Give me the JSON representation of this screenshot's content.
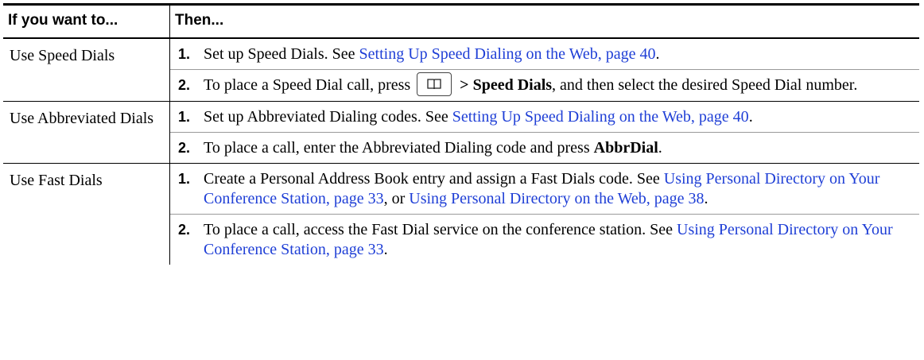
{
  "header": {
    "col1": "If you want to...",
    "col2": "Then..."
  },
  "rows": [
    {
      "label": "Use Speed Dials",
      "steps": [
        {
          "num": "1.",
          "t1": "Set up Speed Dials. See ",
          "link": "Setting Up Speed Dialing on the Web, page 40",
          "t2": "."
        },
        {
          "num": "2.",
          "t1": "To place a Speed Dial call, press",
          "bold": "> Speed Dials",
          "t2": ", and then select the desired Speed Dial number."
        }
      ]
    },
    {
      "label": "Use Abbreviated Dials",
      "steps": [
        {
          "num": "1.",
          "t1": "Set up Abbreviated Dialing codes. See ",
          "link": "Setting Up Speed Dialing on the Web, page 40",
          "t2": "."
        },
        {
          "num": "2.",
          "t1": "To place a call, enter the Abbreviated Dialing code and press ",
          "bold": "AbbrDial",
          "t2": "."
        }
      ]
    },
    {
      "label": "Use Fast Dials",
      "steps": [
        {
          "num": "1.",
          "t1": "Create a Personal Address Book entry and assign a Fast Dials code. See ",
          "link": "Using Personal Directory on Your Conference Station, page 33",
          "t2": ", or ",
          "link2": "Using Personal Directory on the Web, page 38",
          "t3": "."
        },
        {
          "num": "2.",
          "t1": "To place a call, access the Fast Dial service on the conference station. See ",
          "link": "Using Personal Directory on Your Conference Station, page 33",
          "t2": "."
        }
      ]
    }
  ],
  "icons": {
    "directory_key": "book-icon"
  },
  "colors": {
    "link": "#1f3fd6"
  }
}
